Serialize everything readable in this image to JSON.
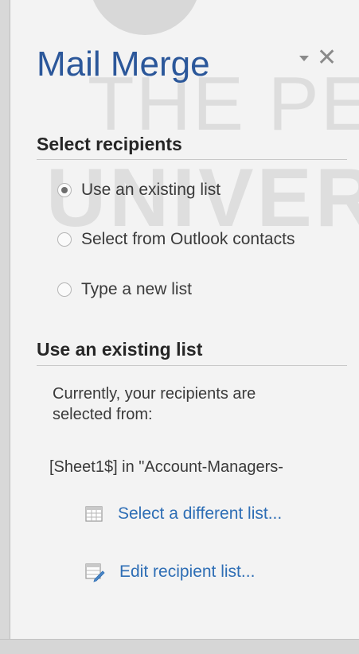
{
  "pane": {
    "title": "Mail Merge"
  },
  "select_recipients": {
    "heading": "Select recipients",
    "options": [
      {
        "label": "Use an existing list",
        "checked": true
      },
      {
        "label": "Select from Outlook contacts",
        "checked": false
      },
      {
        "label": "Type a new list",
        "checked": false
      }
    ]
  },
  "existing_list": {
    "heading": "Use an existing list",
    "description_line1": "Currently, your recipients are",
    "description_line2": "selected from:",
    "source": "[Sheet1$] in \"Account-Managers-",
    "links": {
      "select_different": "Select a different list...",
      "edit_recipients": "Edit recipient list..."
    }
  },
  "watermark": {
    "line1": "THE PEO",
    "line2": "UNIVER"
  },
  "colors": {
    "title": "#2b579a",
    "link": "#2e6eb5",
    "background": "#f3f3f3"
  },
  "icons": {
    "dropdown": "chevron-down-icon",
    "close": "close-icon",
    "select_list": "table-icon",
    "edit_list": "edit-list-icon"
  }
}
